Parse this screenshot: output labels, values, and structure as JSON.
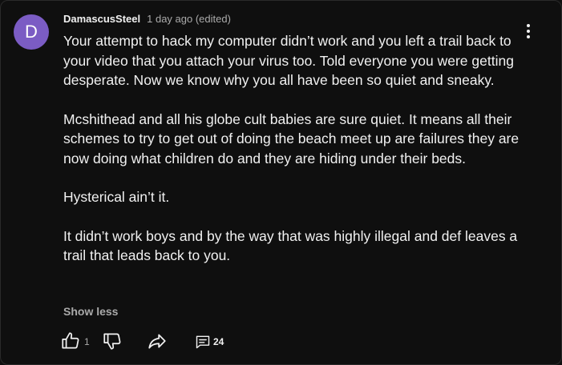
{
  "comment": {
    "avatar_letter": "D",
    "avatar_color": "#7b5cc4",
    "author": "DamascusSteel",
    "meta": "1 day ago (edited)",
    "paragraphs": [
      "Your attempt to hack my computer didn’t work and you left a trail back to your video that you attach your virus too. Told everyone you were getting desperate. Now we know why you all have been so quiet and sneaky.",
      "Mcshithead and all his globe cult babies are sure quiet. It means all their schemes to try to get out of doing the beach meet up are failures they are now doing what children do and they are hiding under their beds.",
      "Hysterical ain’t it.",
      "It didn’t work boys and by the way that was highly illegal and def leaves a trail that leads back to you."
    ],
    "show_less": "Show less",
    "like_count": "1",
    "reply_count": "24"
  },
  "icons": {
    "menu": "more-vertical-icon",
    "like": "thumbs-up-icon",
    "dislike": "thumbs-down-icon",
    "share": "share-arrow-icon",
    "replies": "comment-bubble-icon"
  }
}
